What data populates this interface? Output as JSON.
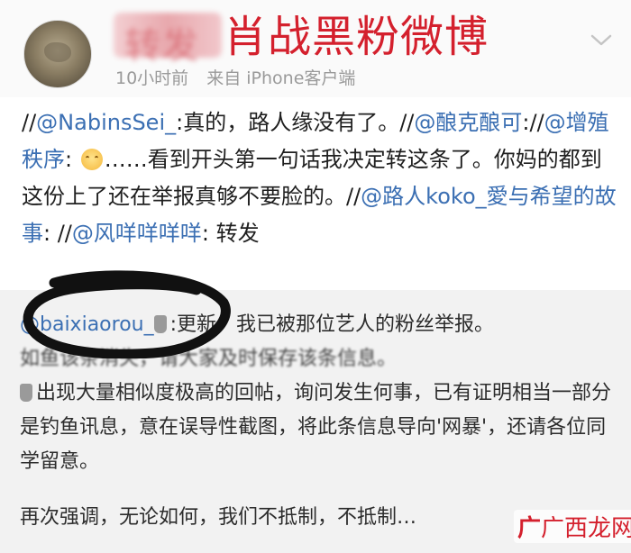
{
  "header": {
    "title_prefix_blurred": "转发",
    "title": "肖战黑粉微博",
    "time": "10小时前",
    "source": "来自 iPhone客户端"
  },
  "repost": {
    "segments": [
      {
        "type": "text",
        "v": "//"
      },
      {
        "type": "at",
        "v": "@NabinsSei_"
      },
      {
        "type": "text",
        "v": ":真的，路人缘没有了。//"
      },
      {
        "type": "at",
        "v": "@酿克酿可"
      },
      {
        "type": "text",
        "v": "://"
      },
      {
        "type": "at",
        "v": "@增殖秩序"
      },
      {
        "type": "text",
        "v": ": "
      },
      {
        "type": "emoji",
        "v": "smile-emoji"
      },
      {
        "type": "text",
        "v": "……看到开头第一句话我决定转这条了。你妈的都到这份上了还在举报真够不要脸的。//"
      },
      {
        "type": "at",
        "v": "@路人koko_愛与希望的故事"
      },
      {
        "type": "text",
        "v": ": //"
      },
      {
        "type": "at",
        "v": "@风咩咩咩咩"
      },
      {
        "type": "text",
        "v": ": 转发"
      }
    ]
  },
  "original": {
    "author": "@baixiaorou_",
    "line1_rest": ":更新：我已被那位艺人的粉丝举报。",
    "line2": "如鱼该条消失，请大家及时保存该条信息。",
    "para2": "出现大量相似度极高的回帖，询问发生何事，已有证明相当一部分是钓鱼讯息，意在误导性截图，将此条信息导向'网暴'，还请各位同学留意。",
    "para3": "再次强调，无论如何，我们不抵制，不抵制…"
  },
  "watermark": {
    "icon": "广",
    "text": "广西龙网"
  },
  "colors": {
    "title": "#d4202d",
    "link": "#3b6fb3",
    "meta": "#9a9a9a",
    "quoted_bg": "#f2f2f2"
  }
}
